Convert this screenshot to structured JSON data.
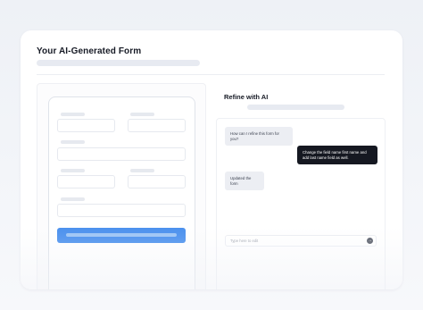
{
  "form": {
    "title": "Your AI-Generated Form"
  },
  "preview": {
    "submit_button": ""
  },
  "refine": {
    "title": "Refine with AI",
    "messages": [
      {
        "role": "ai",
        "text": "How can I refine this form for you?"
      },
      {
        "role": "user",
        "text": "Change the field name first name and add last name field as well."
      },
      {
        "role": "ai",
        "text": "Updated the form"
      }
    ],
    "input_placeholder": "Type here to edit",
    "send_icon": "arrow-right-icon"
  },
  "colors": {
    "accent": "#4a90ee",
    "user_bubble": "#151821",
    "ai_bubble": "#eceef3"
  }
}
